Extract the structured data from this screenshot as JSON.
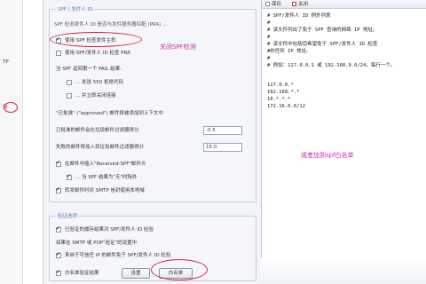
{
  "left_sidebar": {
    "items": [
      "TP",
      "设"
    ]
  },
  "spf_panel": {
    "group_title": "SPF / 发件人 ID",
    "intro": "SPF 检测发件人 ID 是否与发件服务器匹配 (PRA) ...",
    "enable_spf_label": "使用 SPF 检查发件主机",
    "pra_label": "使用 SPF/发件人 ID 检查 PRA",
    "fail_heading": "当 SPF 返回第一个 FAIL 结果:",
    "reject_550_label": "... 发送 550 拒绝代码",
    "close_conn_label": "... 并立即关闭连接",
    "approved_note": "\"已批准\" (\"approved\") 邮件将被添加到上下文中",
    "spam_score_label": "已批准的邮件会在垃圾邮件过滤器得分",
    "spam_score_value": "-0.5",
    "fail_score_label": "失败的邮件将加入到垃圾邮件过滤器得分",
    "fail_score_value": "15.0",
    "insert_header_label": "在邮件中插入\"Received-SPF\"邮件头",
    "exclude_label": "... 当 SPF 结果为\"无\"时除外",
    "smtp_auth_label": "转发邮件时对 SMTP 信封使用本地域",
    "verify_group_title": "验证选项",
    "cache_label": "已验证的缓存结果对 SPF/发件人 ID 检验",
    "smtp_auth_note": "如果在 SMTP 或 POP\"验证\"的设置中",
    "trusted_ip_label": "来自于可信任 IP 的邮件免于 SPF/发件人 ID 检验",
    "whitelist_check_label": "白名单验证结果",
    "button_left": "设置",
    "button_whitelist": "白名单"
  },
  "notepad": {
    "menu": [
      "保存",
      "关闭"
    ],
    "lines": [
      "# SPF/发件人 ID 例外列表",
      "#",
      "# 该文件列出了免于 SPF 查询的网络 IP 地址。",
      "#",
      "# 该文件中包括您希望免于 SPF/发件人 ID 检查",
      "#的任何 IP 地址。",
      "#",
      "# 例如：127.0.0.1 或 192.168.0.0/24，每行一个。",
      "",
      "127.0.0.*",
      "192.168.*.*",
      "10.*.*.*",
      "172.16.0.0/12"
    ]
  },
  "annotations": {
    "close_spf": "关闭SPF检测",
    "add_whitelist": "或者加到spf白名单"
  },
  "colors": {
    "annotation": "#d02aa8",
    "circle": "#d8234a",
    "group_title": "#5a7ab8"
  }
}
